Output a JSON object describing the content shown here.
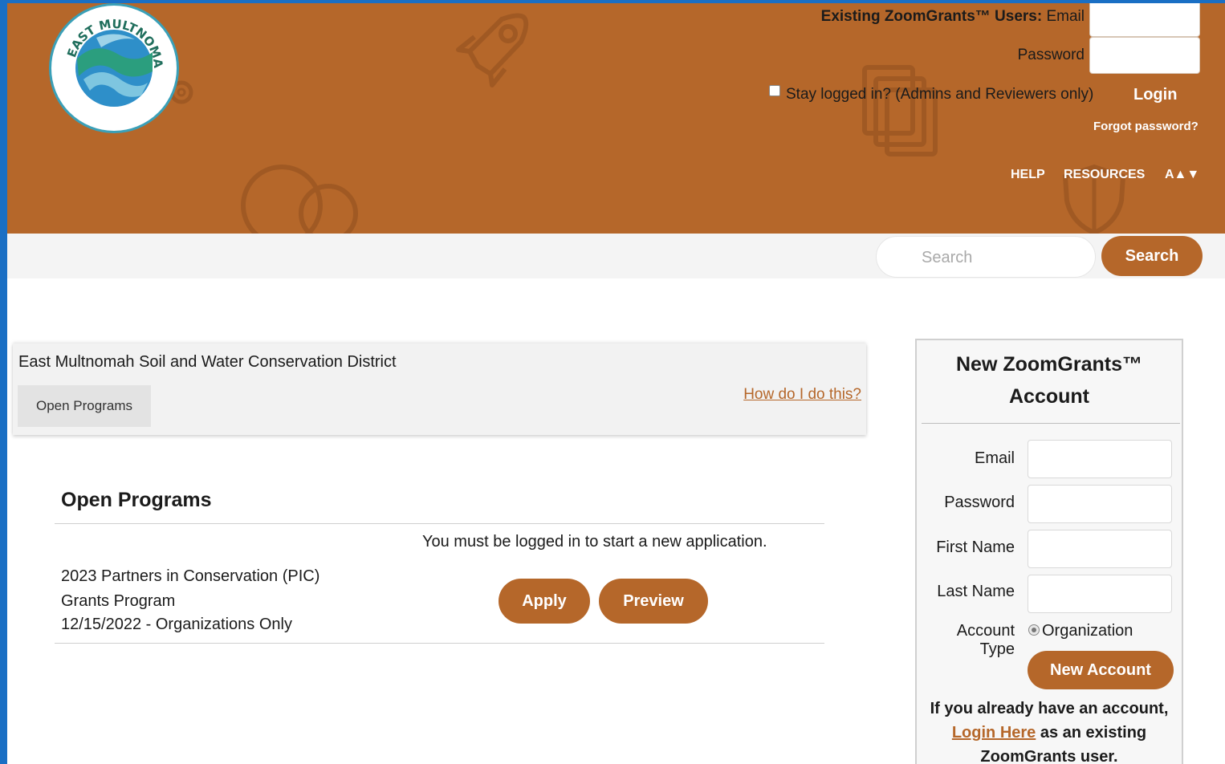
{
  "header": {
    "org_logo_alt": "East Multnomah soil & water conservation district",
    "login": {
      "email_label_bold": "Existing ZoomGrants™ Users:",
      "email_label": "Email",
      "password_label": "Password",
      "stay_logged_in": "Stay logged in? (Admins and Reviewers only)",
      "login_button": "Login",
      "forgot_password": "Forgot password?"
    },
    "nav": {
      "help": "HELP",
      "resources": "RESOURCES",
      "font_size": "A▲▼"
    }
  },
  "search": {
    "placeholder": "Search",
    "button": "Search"
  },
  "org_panel": {
    "title": "East Multnomah Soil and Water Conservation District",
    "tab": "Open Programs",
    "help_link": "How do I do this?"
  },
  "open_programs": {
    "title": "Open Programs",
    "notice": "You must be logged in to start a new application.",
    "programs": [
      {
        "name": "2023 Partners in Conservation (PIC)",
        "type": "Grants Program",
        "deadline": "12/15/2022 - Organizations Only",
        "apply_label": "Apply",
        "preview_label": "Preview"
      }
    ]
  },
  "new_account": {
    "title_line1": "New ZoomGrants™",
    "title_line2": "Account",
    "email_label": "Email",
    "password_label": "Password",
    "first_name_label": "First Name",
    "last_name_label": "Last Name",
    "account_type_label": "Account Type",
    "account_type_value": "Organization",
    "button": "New Account",
    "msg_line1": "If you already have an account,",
    "msg_link": "Login Here",
    "msg_line2_rest": " as an existing",
    "msg_line3": "ZoomGrants user."
  },
  "colors": {
    "brand": "#b5672a",
    "window_frame": "#1a6fc4"
  }
}
